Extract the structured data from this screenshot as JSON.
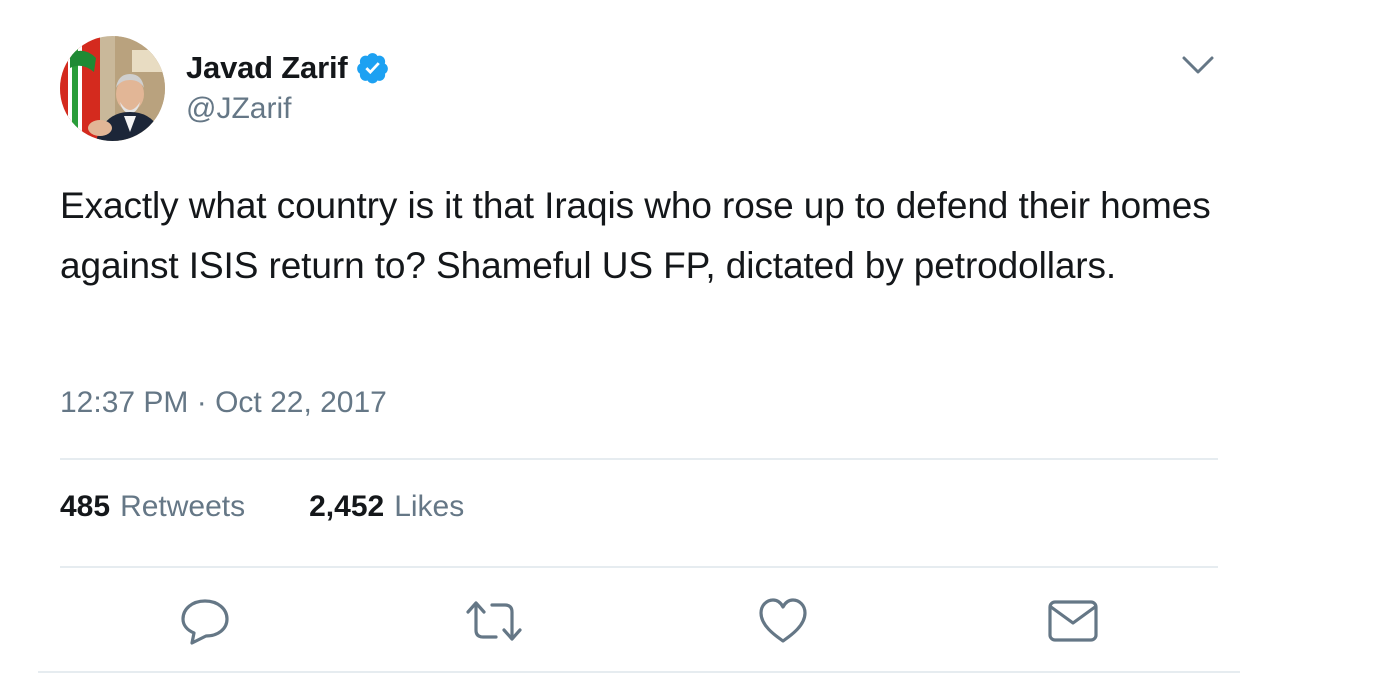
{
  "author": {
    "display_name": "Javad Zarif",
    "handle": "@JZarif",
    "verified": true,
    "avatar_icon": "profile-photo"
  },
  "tweet": {
    "text": "Exactly what country is it that Iraqis who rose up to defend their homes against ISIS return to? Shameful US FP, dictated by petrodollars.",
    "timestamp": "12:37 PM · Oct 22, 2017"
  },
  "stats": {
    "retweets_count": "485",
    "retweets_label": "Retweets",
    "likes_count": "2,452",
    "likes_label": "Likes"
  },
  "actions": {
    "reply_icon": "reply-icon",
    "retweet_icon": "retweet-icon",
    "like_icon": "heart-icon",
    "dm_icon": "envelope-icon"
  },
  "colors": {
    "text_primary": "#14171a",
    "text_secondary": "#657786",
    "verified_blue": "#1da1f2",
    "divider": "#e6ecf0"
  }
}
